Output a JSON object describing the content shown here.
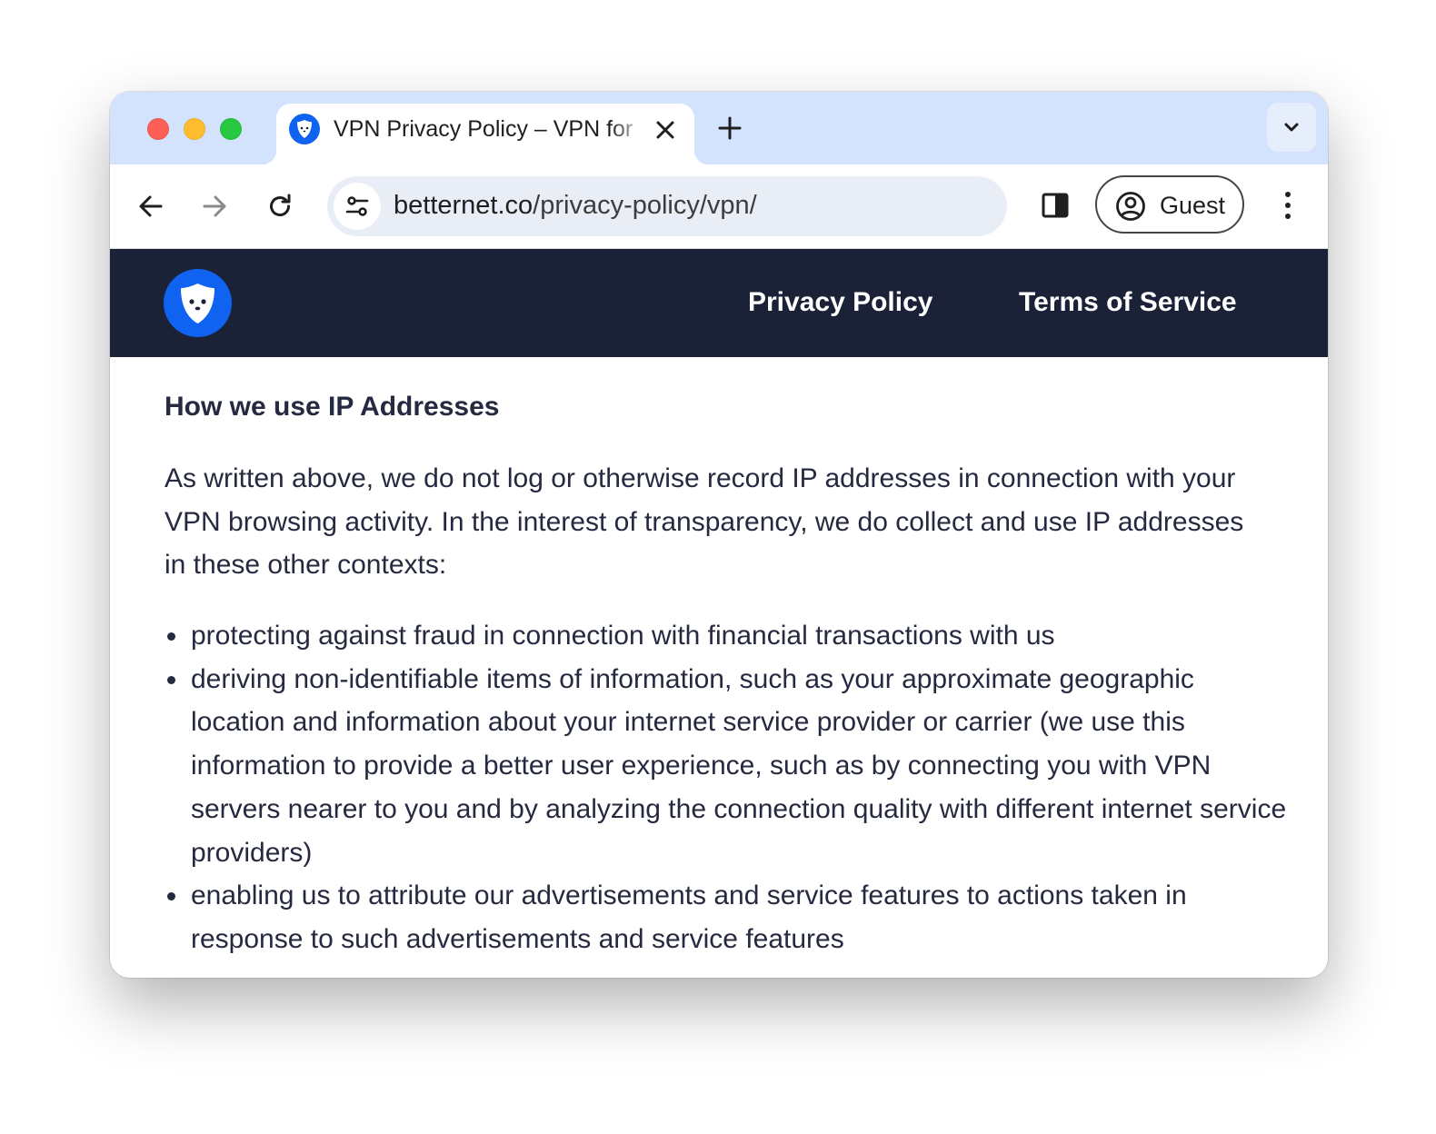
{
  "browser": {
    "tab": {
      "title": "VPN Privacy Policy – VPN for",
      "favicon": "betternet-shield-icon"
    },
    "address_bar": {
      "domain": "betternet.co",
      "path": "/privacy-policy/vpn/"
    },
    "profile": {
      "label": "Guest",
      "icon": "account-circle-icon"
    },
    "icons": {
      "back": "arrow-left-icon",
      "forward": "arrow-right-icon",
      "reload": "reload-icon",
      "site_info": "tune-icon",
      "side_panel": "side-panel-icon",
      "menu": "three-dots-vertical-icon",
      "new_tab": "plus-icon",
      "tab_search": "chevron-down-icon",
      "close_tab": "close-icon"
    }
  },
  "site": {
    "logo": "betternet-shield-logo",
    "nav": {
      "privacy_policy": "Privacy Policy",
      "terms_of_service": "Terms of Service"
    },
    "colors": {
      "header_bg": "#1b2136",
      "brand_blue": "#1063f0",
      "text": "#262a40"
    }
  },
  "content": {
    "heading": "How we use IP Addresses",
    "intro": "As written above, we do not log or otherwise record IP addresses in connection with your VPN browsing activity. In the interest of transparency, we do collect and use IP addresses in these other contexts:",
    "bullets": [
      "protecting against fraud in connection with financial transactions with us",
      "deriving non-identifiable items of information, such as your approximate geographic location and information about your internet service provider or carrier (we use this information to provide a better user experience, such as by connecting you with VPN servers nearer to you and by analyzing the connection quality with different internet service providers)",
      "enabling us to attribute our advertisements and service features to actions taken in response to such advertisements and service features"
    ]
  }
}
